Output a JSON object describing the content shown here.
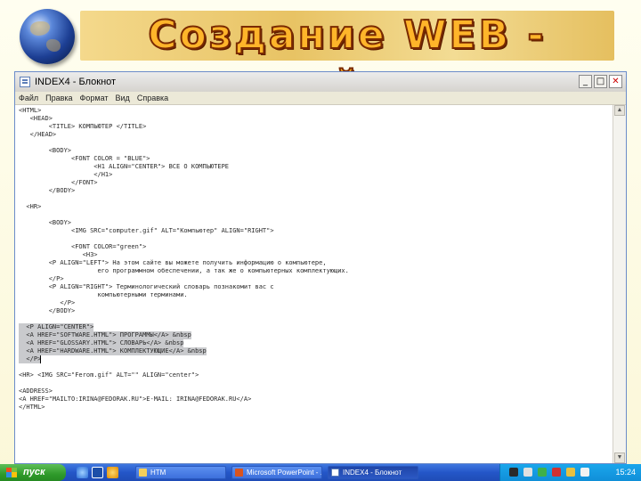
{
  "slide": {
    "title": "Создание WEB - сайта",
    "globe_icon": "globe-icon"
  },
  "window": {
    "title": "INDEX4 - Блокнот",
    "app_icon": "notepad-icon",
    "controls": {
      "minimize": "_",
      "maximize": "□",
      "close": "✕"
    }
  },
  "menu": [
    "Файл",
    "Правка",
    "Формат",
    "Вид",
    "Справка"
  ],
  "editor": {
    "lines": [
      {
        "text": "<HTML>",
        "selected": false
      },
      {
        "text": "   <HEAD>",
        "selected": false
      },
      {
        "text": "        <TITLE> КОМПЬЮТЕР </TITLE>",
        "selected": false
      },
      {
        "text": "   </HEAD>",
        "selected": false
      },
      {
        "text": "",
        "selected": false
      },
      {
        "text": "        <BODY>",
        "selected": false
      },
      {
        "text": "              <FONT COLOR = \"BLUE\">",
        "selected": false
      },
      {
        "text": "                    <H1 ALIGN=\"CENTER\"> ВСЕ О КОМПЬЮТЕРЕ",
        "selected": false
      },
      {
        "text": "                    </H1>",
        "selected": false
      },
      {
        "text": "              </FONT>",
        "selected": false
      },
      {
        "text": "        </BODY>",
        "selected": false
      },
      {
        "text": "",
        "selected": false
      },
      {
        "text": "  <HR>",
        "selected": false
      },
      {
        "text": "",
        "selected": false
      },
      {
        "text": "        <BODY>",
        "selected": false
      },
      {
        "text": "              <IMG SRC=\"computer.gif\" ALT=\"Компьютер\" ALIGN=\"RIGHT\">",
        "selected": false
      },
      {
        "text": "",
        "selected": false
      },
      {
        "text": "              <FONT COLOR=\"green\">",
        "selected": false
      },
      {
        "text": "                 <H3>",
        "selected": false
      },
      {
        "text": "        <P ALIGN=\"LEFT\"> На этом сайте вы можете получить информацию о компьютере,",
        "selected": false
      },
      {
        "text": "                     его программном обеспечении, а так же о компьютерных комплектующих.",
        "selected": false
      },
      {
        "text": "        </P>",
        "selected": false
      },
      {
        "text": "        <P ALIGN=\"RIGHT\"> Терминологический словарь познакомит вас с",
        "selected": false
      },
      {
        "text": "                     компьютерными терминами.",
        "selected": false
      },
      {
        "text": "           </P>",
        "selected": false
      },
      {
        "text": "        </BODY>",
        "selected": false
      },
      {
        "text": "",
        "selected": false
      },
      {
        "text": "  <P ALIGN=\"CENTER\">",
        "selected": true
      },
      {
        "text": "  <A HREF=\"SOFTWARE.HTML\"> ПРОГРАММЫ</A> &nbsp",
        "selected": true
      },
      {
        "text": "  <A HREF=\"GLOSSARY.HTML\"> СЛОВАРЬ</A> &nbsp",
        "selected": true
      },
      {
        "text": "  <A HREF=\"HARDWARE.HTML\"> КОМПЛЕКТУЮЩИЕ</A> &nbsp",
        "selected": true
      },
      {
        "text": "  </P>",
        "selected": true
      },
      {
        "text": "",
        "selected": false
      },
      {
        "text": "<HR> <IMG SRC=\"Ferom.gif\" ALT=\"\" ALIGN=\"center\">",
        "selected": false
      },
      {
        "text": "",
        "selected": false
      },
      {
        "text": "<ADDRESS>",
        "selected": false
      },
      {
        "text": "<A HREF=\"MAILTO:IRINA@FEDORAK.RU\">E-MAIL: IRINA@FEDORAK.RU</A>",
        "selected": false
      },
      {
        "text": "</HTML>",
        "selected": false
      }
    ]
  },
  "taskbar": {
    "start_label": "пуск",
    "quick_launch": [
      "ie-icon",
      "outlook-icon",
      "media-icon"
    ],
    "tasks": [
      {
        "label": "HTM",
        "icon": "folder-icon",
        "active": false
      },
      {
        "label": "Microsoft PowerPoint - ...",
        "icon": "powerpoint-icon",
        "active": false
      },
      {
        "label": "INDEX4 - Блокнот",
        "icon": "notepad-icon",
        "active": true
      }
    ],
    "clock": "15:24",
    "colors": {
      "taskbar": "#2456c8",
      "start": "#2f9a2b",
      "tray": "#108fd8"
    }
  }
}
